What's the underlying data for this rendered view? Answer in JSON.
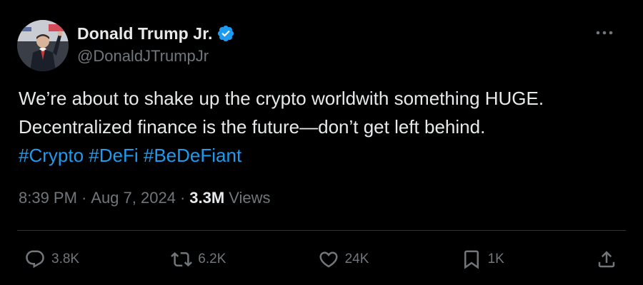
{
  "author": {
    "display_name": "Donald Trump Jr.",
    "handle": "@DonaldJTrumpJr",
    "verified": true,
    "verified_color": "#1d9bf0"
  },
  "tweet": {
    "line1": "We’re about to shake up the crypto worldwith something HUGE.",
    "line2": "Decentralized finance is the future—don’t get left behind.",
    "hashtags": [
      "#Crypto",
      "#DeFi",
      "#BeDeFiant"
    ],
    "hashtag_color": "#1d9bf0"
  },
  "meta": {
    "time": "8:39 PM",
    "separator": "·",
    "date": "Aug 7, 2024",
    "views_count": "3.3M",
    "views_label": "Views"
  },
  "actions": {
    "replies": "3.8K",
    "retweets": "6.2K",
    "likes": "24K",
    "bookmarks": "1K"
  },
  "icons": {
    "more": "more-horizontal-icon",
    "reply": "reply-icon",
    "retweet": "retweet-icon",
    "like": "heart-icon",
    "bookmark": "bookmark-icon",
    "share": "share-icon",
    "verified": "verified-badge-icon"
  },
  "colors": {
    "background": "#000000",
    "text": "#e7e9ea",
    "secondary": "#71767b",
    "divider": "#2f3336"
  }
}
